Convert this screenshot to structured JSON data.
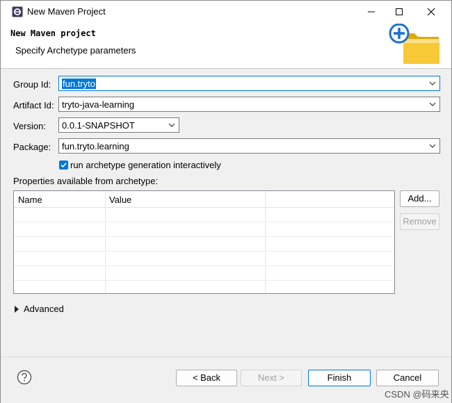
{
  "window": {
    "title": "New Maven Project"
  },
  "banner": {
    "title": "New Maven project",
    "subtitle": "Specify Archetype parameters",
    "icon": "new-folder-icon"
  },
  "form": {
    "group_id": {
      "label": "Group Id:",
      "value": "fun.tryto"
    },
    "artifact_id": {
      "label": "Artifact Id:",
      "value": "tryto-java-learning"
    },
    "version": {
      "label": "Version:",
      "value": "0.0.1-SNAPSHOT"
    },
    "package": {
      "label": "Package:",
      "value": "fun.tryto.learning"
    },
    "interactive": {
      "label": "run archetype generation interactively",
      "checked": true
    },
    "properties_label": "Properties available from archetype:"
  },
  "table": {
    "columns": [
      "Name",
      "Value"
    ]
  },
  "side_buttons": {
    "add": "Add...",
    "remove": "Remove"
  },
  "advanced": {
    "label": "Advanced"
  },
  "footer": {
    "back": "< Back",
    "next": "Next >",
    "finish": "Finish",
    "cancel": "Cancel"
  },
  "watermark": "CSDN @码来央",
  "colors": {
    "accent": "#0078d7",
    "folder": "#f5c518"
  }
}
